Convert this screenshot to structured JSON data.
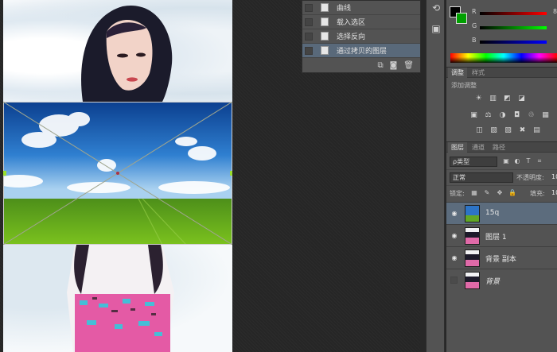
{
  "history": {
    "items": [
      {
        "label": "曲线"
      },
      {
        "label": "载入选区"
      },
      {
        "label": "选择反向"
      },
      {
        "label": "通过拷贝的图层"
      }
    ],
    "footer_icons": [
      "new-snapshot-icon",
      "camera-icon",
      "trash-icon"
    ]
  },
  "color_panel": {
    "channels": [
      {
        "name": "R",
        "value": "8",
        "gradient": [
          "#000000",
          "#ff0000"
        ]
      },
      {
        "name": "G",
        "value": "",
        "gradient": [
          "#000000",
          "#00ff00"
        ]
      },
      {
        "name": "B",
        "value": "",
        "gradient": [
          "#000000",
          "#0000ff"
        ]
      }
    ],
    "fg_color": "#000000",
    "bg_color": "#00a000"
  },
  "adjustments": {
    "tabs": [
      "调整",
      "样式"
    ],
    "add_label": "添加调整",
    "rows": [
      [
        "brightness-icon",
        "levels-icon",
        "curves-icon",
        "exposure-icon"
      ],
      [
        "vibrance-icon",
        "hue-saturation-icon",
        "color-balance-icon",
        "bw-icon",
        "photo-filter-icon",
        "channel-mixer-icon",
        "color-lookup-icon"
      ],
      [
        "invert-icon",
        "posterize-icon",
        "threshold-icon",
        "selective-color-icon",
        "gradient-map-icon"
      ]
    ]
  },
  "layers": {
    "tabs": [
      "图层",
      "通道",
      "路径"
    ],
    "kind_label": "ρ类型",
    "blend_mode": "正常",
    "opacity_label": "不透明度:",
    "opacity_value": "10",
    "lock_label": "锁定:",
    "fill_label": "填充:",
    "fill_value": "10",
    "items": [
      {
        "name": "15q",
        "visible": true,
        "selected": true,
        "italic": false
      },
      {
        "name": "图层 1",
        "visible": true,
        "selected": false,
        "italic": false
      },
      {
        "name": "背景 副本",
        "visible": true,
        "selected": false,
        "italic": false
      },
      {
        "name": "背景",
        "visible": false,
        "selected": false,
        "italic": true
      }
    ]
  }
}
